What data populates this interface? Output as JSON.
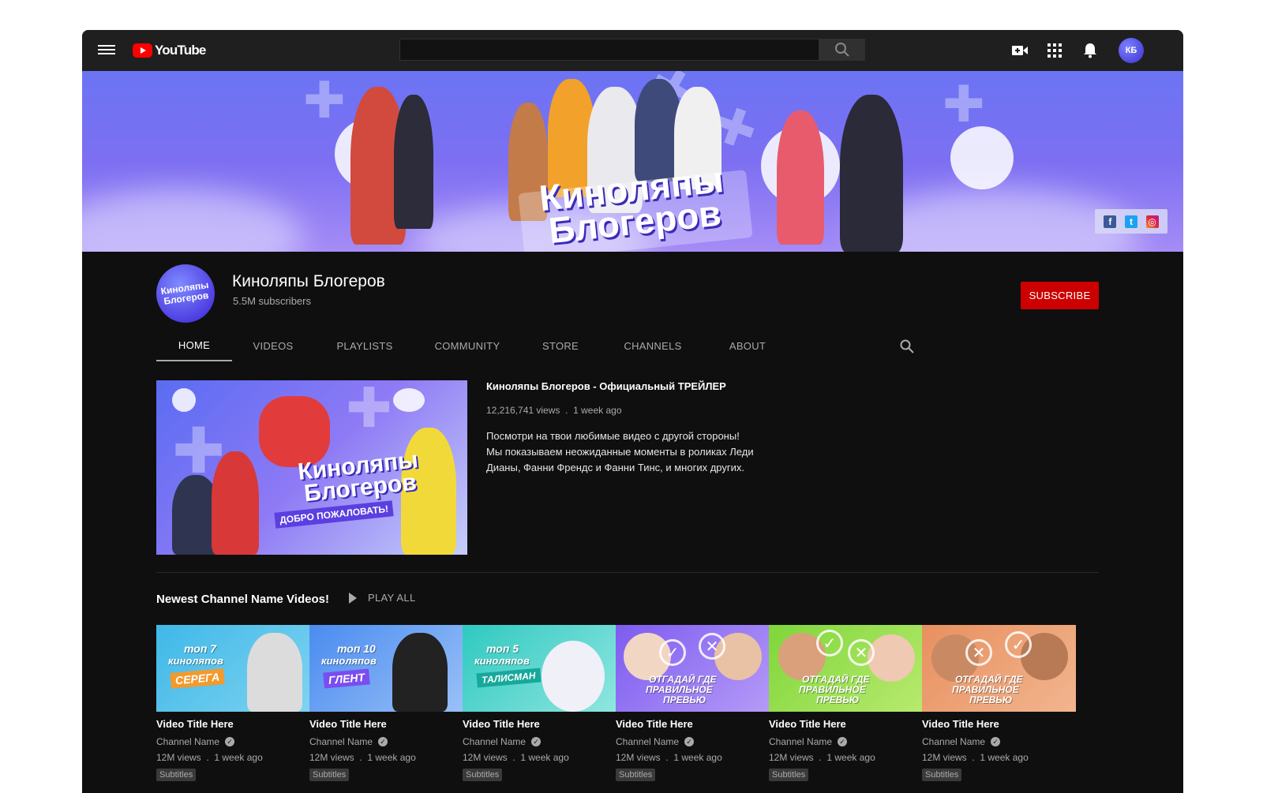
{
  "topbar": {
    "logo_text": "YouTube",
    "search_placeholder": "",
    "avatar_initials": "КБ",
    "icons": [
      "menu-icon",
      "search-icon",
      "video-camera-icon",
      "apps-grid-icon",
      "bell-icon"
    ]
  },
  "banner": {
    "title": "Киноляпы Блогеров",
    "social": [
      "facebook-icon",
      "twitter-icon",
      "instagram-icon"
    ]
  },
  "channel": {
    "avatar_text": "Киноляпы Блогеров",
    "name": "Киноляпы Блогеров",
    "subscribers": "5.5M subscribers",
    "subscribe_label": "SUBSCRIBE"
  },
  "tabs": [
    {
      "label": "HOME"
    },
    {
      "label": "VIDEOS"
    },
    {
      "label": "PLAYLISTS"
    },
    {
      "label": "COMMUNITY"
    },
    {
      "label": "STORE"
    },
    {
      "label": "CHANNELS"
    },
    {
      "label": "ABOUT"
    }
  ],
  "featured": {
    "thumb_title": "Киноляпы Блогеров",
    "thumb_subtitle": "ДОБРО ПОЖАЛОВАТЬ!",
    "title": "Киноляпы Блогеров - Официальный ТРЕЙЛЕР",
    "views": "12,216,741 views",
    "age": "1 week ago",
    "description": [
      "Посмотри на твои любимые видео с другой стороны!",
      "Мы показываем неожиданные моменты в роликах Леди",
      "Дианы, Фанни Френдс и  Фанни Тинс, и многих других."
    ]
  },
  "shelf": {
    "title": "Newest Channel Name Videos!",
    "play_all": "PLAY ALL"
  },
  "videos": [
    {
      "thumb_top": "топ 7",
      "thumb_mid": "киноляпов",
      "thumb_tag": "СЕРЕГА",
      "title": "Video Title Here",
      "channel": "Channel Name",
      "views": "12M views",
      "age": "1 week ago",
      "badge": "Subtitles"
    },
    {
      "thumb_top": "топ 10",
      "thumb_mid": "киноляпов",
      "thumb_tag": "ГЛЕНТ",
      "title": "Video Title Here",
      "channel": "Channel Name",
      "views": "12M views",
      "age": "1 week ago",
      "badge": "Subtitles"
    },
    {
      "thumb_top": "топ 5",
      "thumb_mid": "киноляпов",
      "thumb_tag": "ТАЛИСМАН",
      "title": "Video Title Here",
      "channel": "Channel Name",
      "views": "12M views",
      "age": "1 week ago",
      "badge": "Subtitles"
    },
    {
      "thumb_top": "ОТГАДАЙ ГДЕ",
      "thumb_mid": "ПРАВИЛЬНОЕ",
      "thumb_tag": "ПРЕВЬЮ",
      "title": "Video Title Here",
      "channel": "Channel Name",
      "views": "12M views",
      "age": "1 week ago",
      "badge": "Subtitles"
    },
    {
      "thumb_top": "ОТГАДАЙ ГДЕ",
      "thumb_mid": "ПРАВИЛЬНОЕ",
      "thumb_tag": "ПРЕВЬЮ",
      "title": "Video Title Here",
      "channel": "Channel Name",
      "views": "12M views",
      "age": "1 week ago",
      "badge": "Subtitles"
    },
    {
      "thumb_top": "ОТГАДАЙ ГДЕ",
      "thumb_mid": "ПРАВИЛЬНОЕ",
      "thumb_tag": "ПРЕВЬЮ",
      "title": "Video Title Here",
      "channel": "Channel Name",
      "views": "12M views",
      "age": "1 week ago",
      "badge": "Subtitles"
    }
  ],
  "colors": {
    "background": "#0f0f0f",
    "topbar": "#1f1f1f",
    "subscribe": "#cc0000",
    "banner": "#7d6ff2"
  }
}
